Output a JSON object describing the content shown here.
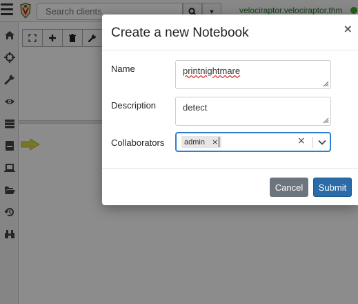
{
  "app": {
    "search": {
      "placeholder": "Search clients"
    },
    "server_name": "velociraptor.velociraptor.thm",
    "colors": {
      "status": "#3caa3c",
      "accent": "#2b6ba8"
    },
    "sidebar_icons": [
      "home-icon",
      "crosshair-icon",
      "wrench-icon",
      "eye-icon",
      "server-icon",
      "notebook-icon",
      "laptop-icon",
      "folder-open-icon",
      "history-icon",
      "binoculars-icon"
    ],
    "toolbar_icons": [
      "expand-icon",
      "plus-icon",
      "trash-icon",
      "wrench-icon"
    ]
  },
  "modal": {
    "title": "Create a new Notebook",
    "close_label": "×",
    "fields": {
      "name": {
        "label": "Name",
        "value": "printnightmare"
      },
      "description": {
        "label": "Description",
        "value": "detect"
      },
      "collaborators": {
        "label": "Collaborators",
        "selected": [
          "admin"
        ],
        "tag_remove": "×",
        "clear": "×"
      }
    },
    "buttons": {
      "cancel": "Cancel",
      "submit": "Submit"
    }
  }
}
